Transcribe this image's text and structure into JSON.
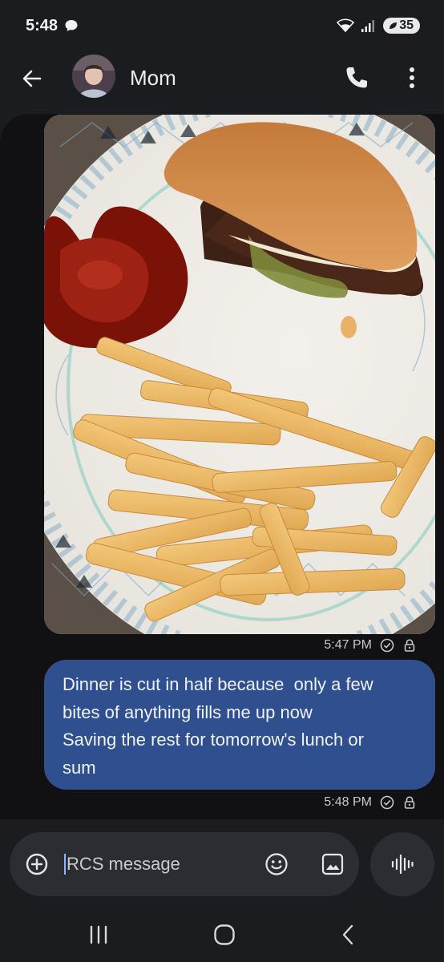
{
  "status_bar": {
    "time": "5:48",
    "battery": "35"
  },
  "header": {
    "contact_name": "Mom"
  },
  "messages": [
    {
      "type": "image",
      "time": "5:47 PM"
    },
    {
      "type": "text",
      "lines": [
        "Dinner is cut in half because  only a few",
        "bites of anything fills me up now",
        "Saving the rest for tomorrow's lunch or",
        "sum"
      ],
      "time": "5:48 PM"
    }
  ],
  "compose": {
    "placeholder": "RCS message"
  },
  "icons": {
    "back": "arrow-left-icon",
    "call": "phone-icon",
    "more": "more-vert-icon",
    "add": "add-circle-icon",
    "emoji": "emoji-icon",
    "gallery": "image-icon",
    "voice": "voice-wave-icon",
    "read_receipt": "check-circle-icon",
    "encrypted": "lock-icon"
  },
  "colors": {
    "background": "#1b1c20",
    "thread": "#111114",
    "sent_bubble": "#2f4f8e",
    "compose": "#2c2d32"
  }
}
